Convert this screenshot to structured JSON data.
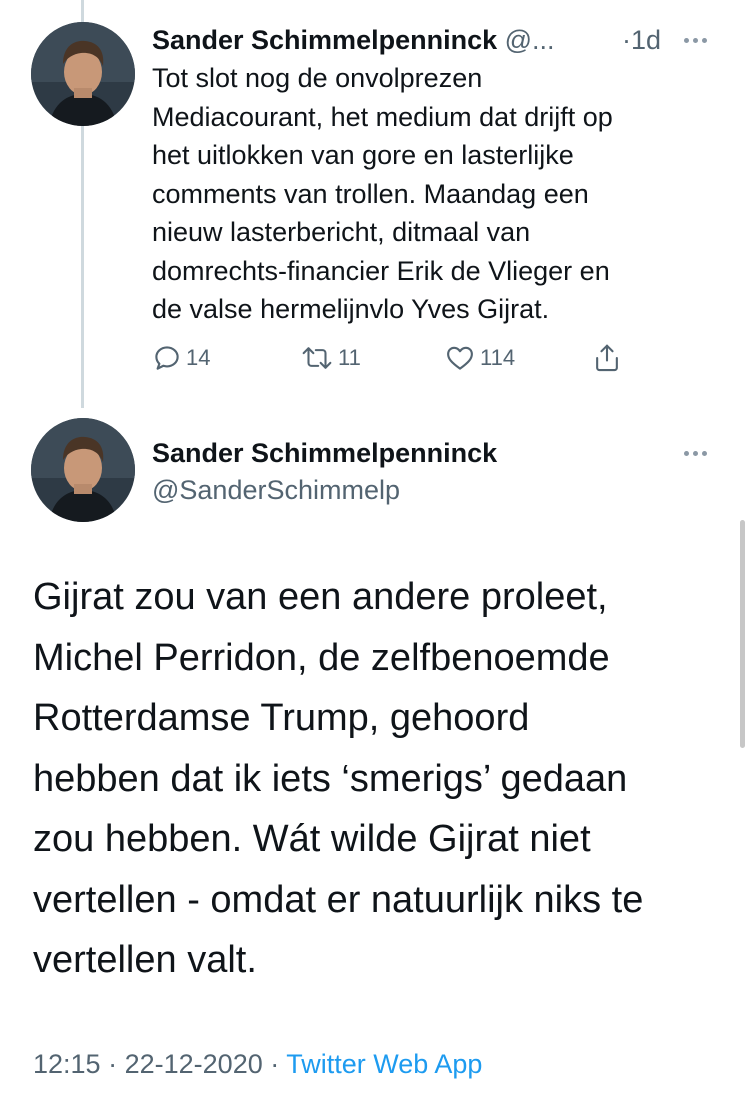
{
  "colors": {
    "text": "#0f1419",
    "secondary": "#536471",
    "link": "#1d9bf0",
    "thread_line": "#cfd9de"
  },
  "tweet1": {
    "author_name": "Sander Schimmelpenninck",
    "author_handle": "@...",
    "time_separator": "·",
    "time": "1d",
    "text": "Tot slot nog de onvolprezen\nMediacourant, het medium dat drijft op\nhet uitlokken van gore en lasterlijke\ncomments van trollen. Maandag een\nnieuw lasterbericht, ditmaal van\ndomrechts-financier Erik de Vlieger en\nde valse hermelijnvlo Yves Gijrat.",
    "actions": {
      "reply_icon": "reply-icon",
      "reply_count": "14",
      "retweet_icon": "retweet-icon",
      "retweet_count": "11",
      "like_icon": "heart-icon",
      "like_count": "114",
      "share_icon": "share-icon"
    }
  },
  "tweet2": {
    "author_name": "Sander Schimmelpenninck",
    "author_handle": "@SanderSchimmelp",
    "text": "Gijrat zou van een andere proleet,\nMichel Perridon, de zelfbenoemde\nRotterdamse Trump, gehoord\nhebben dat ik iets ‘smerigs’ gedaan\nzou hebben. Wát wilde Gijrat niet\nvertellen - omdat er natuurlijk niks te\nvertellen valt.",
    "time": "12:15",
    "separator": "·",
    "date": "22-12-2020",
    "source": "Twitter Web App"
  }
}
